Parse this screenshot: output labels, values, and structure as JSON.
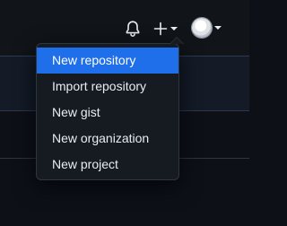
{
  "header": {
    "bell_icon": "bell-icon",
    "create_icon": "plus-icon",
    "create_caret_icon": "caret-down-icon",
    "avatar_caret_icon": "caret-down-icon"
  },
  "create_menu": {
    "items": [
      {
        "label": "New repository",
        "active": true
      },
      {
        "label": "Import repository",
        "active": false
      },
      {
        "label": "New gist",
        "active": false
      },
      {
        "label": "New organization",
        "active": false
      },
      {
        "label": "New project",
        "active": false
      }
    ]
  },
  "colors": {
    "background": "#0d1117",
    "menu_background": "#161b22",
    "menu_border": "#30363d",
    "highlight": "#1f6feb",
    "text": "#e6edf3"
  }
}
